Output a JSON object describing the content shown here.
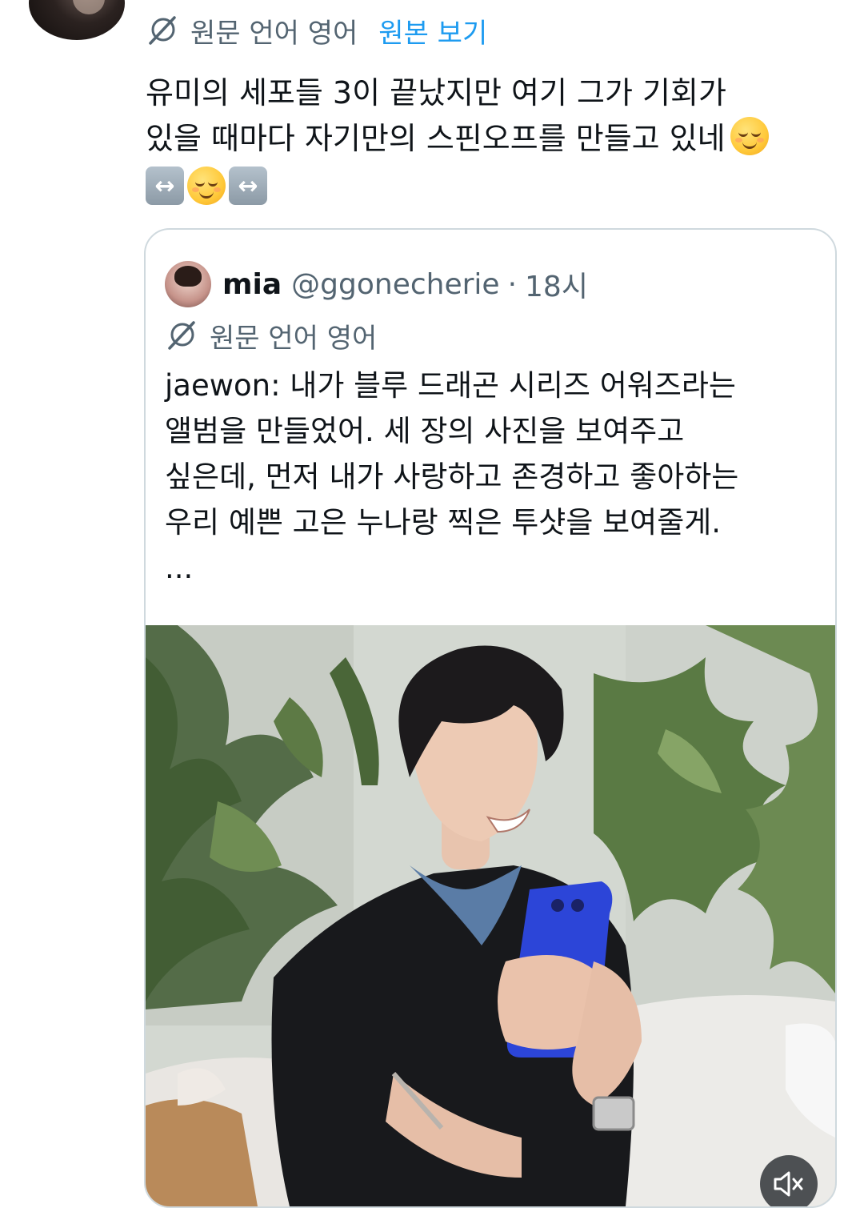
{
  "reply": {
    "translation_label": "원문 언어 영어",
    "show_original_label": "원본 보기",
    "text_lines": [
      "유미의 세포들 3이 끝났지만 여기 그가 기회가",
      "있을 때마다 자기만의 스핀오프를 만들고 있네"
    ]
  },
  "quote": {
    "name": "mia",
    "handle": "@ggonecherie",
    "separator": "·",
    "time": "18시",
    "translation_label": "원문 언어 영어",
    "text_lines": [
      "jaewon: 내가 블루 드래곤 시리즈 어워즈라는",
      "앨범을 만들었어. 세 장의 사진을 보여주고",
      "싶은데, 먼저 내가 사랑하고 존경하고 좋아하는",
      "우리 예쁜 고은 누나랑 찍은 투샷을 보여줄게.",
      "..."
    ]
  },
  "icons": {
    "translate": "globe-slash-icon",
    "emoji_relieved": "relieved-face-icon",
    "emoji_arrows": "left-right-arrow-icon",
    "mute": "volume-muted-icon"
  },
  "colors": {
    "link": "#1d9bf0",
    "secondary_text": "#536471",
    "card_border": "#cfd9de"
  }
}
